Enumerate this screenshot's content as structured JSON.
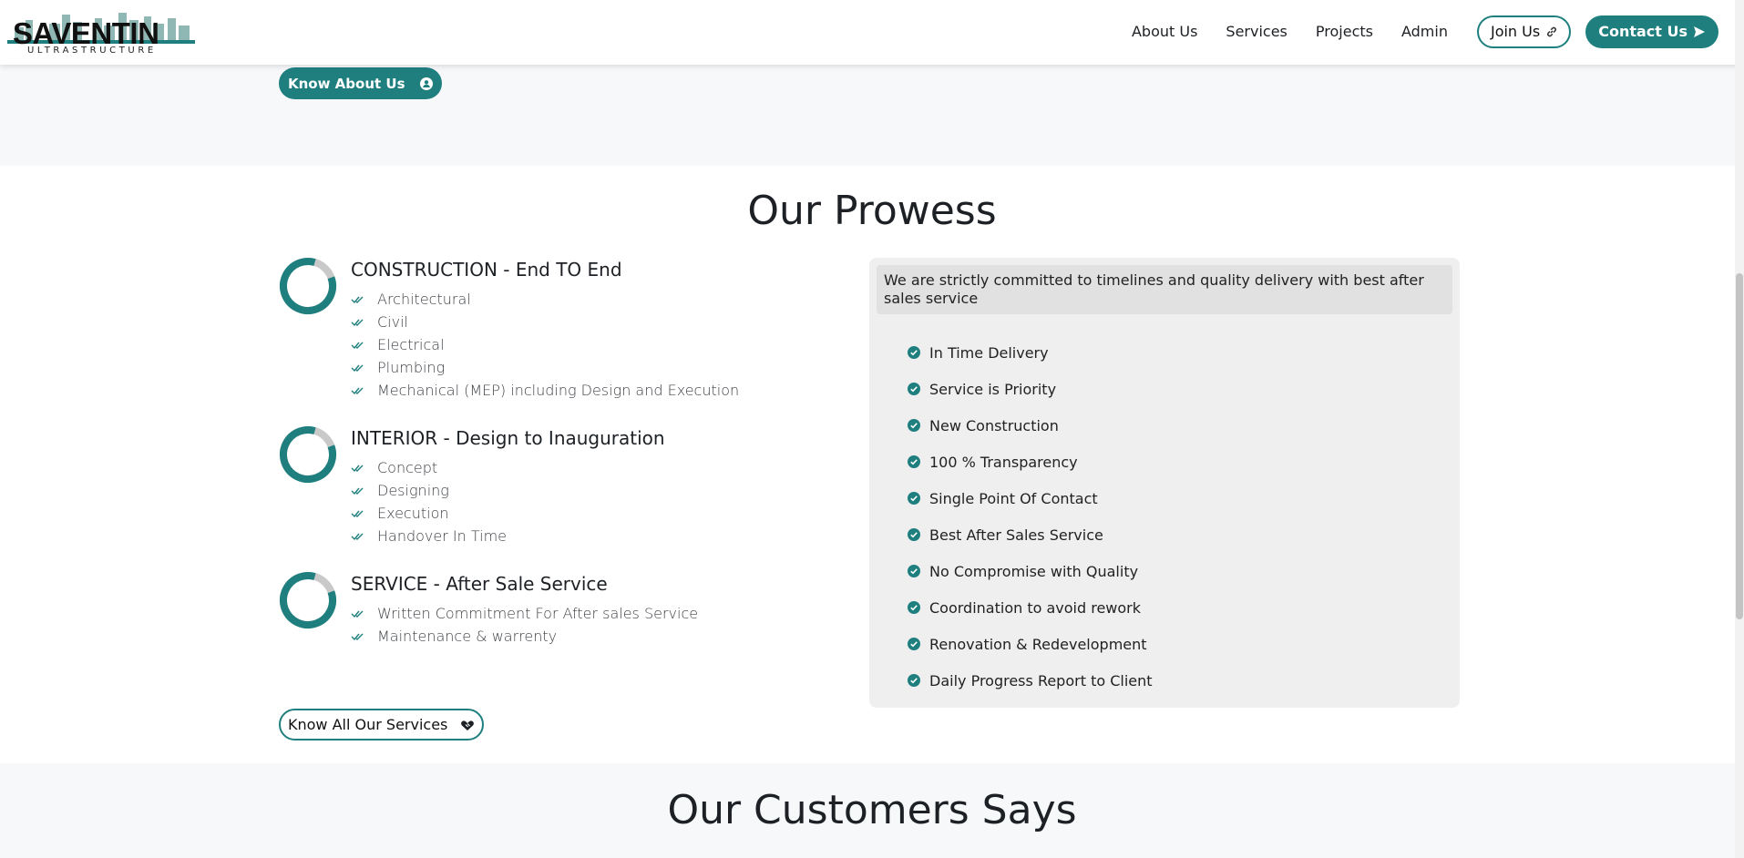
{
  "brand": {
    "name": "SAVENTIN",
    "tagline": "ULTRASTRUCTURE",
    "accent_color": "#1f7f7f"
  },
  "nav": {
    "links": [
      "About Us",
      "Services",
      "Projects",
      "Admin"
    ],
    "join_label": "Join Us",
    "contact_label": "Contact Us"
  },
  "about_button": {
    "label": "Know About Us",
    "icon": "user-circle-icon"
  },
  "prowess": {
    "title": "Our Prowess",
    "services": [
      {
        "title": "CONSTRUCTION - End TO End",
        "items": [
          "Architectural",
          "Civil",
          "Electrical",
          "Plumbing",
          "Mechanical (MEP) including Design and Execution"
        ]
      },
      {
        "title": "INTERIOR - Design to Inauguration",
        "items": [
          "Concept",
          "Designing",
          "Execution",
          "Handover In Time"
        ]
      },
      {
        "title": "SERVICE - After Sale Service",
        "items": [
          "Written Commitment For After sales Service",
          "Maintenance & warrenty"
        ]
      }
    ],
    "commitment": "We are strictly committed to timelines and quality delivery with best after sales service",
    "highlights": [
      "In Time Delivery",
      "Service is Priority",
      "New Construction",
      "100 % Transparency",
      "Single Point Of Contact",
      "Best After Sales Service",
      "No Compromise with Quality",
      "Coordination to avoid rework",
      "Renovation & Redevelopment",
      "Daily Progress Report to Client"
    ],
    "services_button": {
      "label": "Know All Our Services",
      "icon": "handshake-icon"
    }
  },
  "customers": {
    "title": "Our Customers Says"
  }
}
